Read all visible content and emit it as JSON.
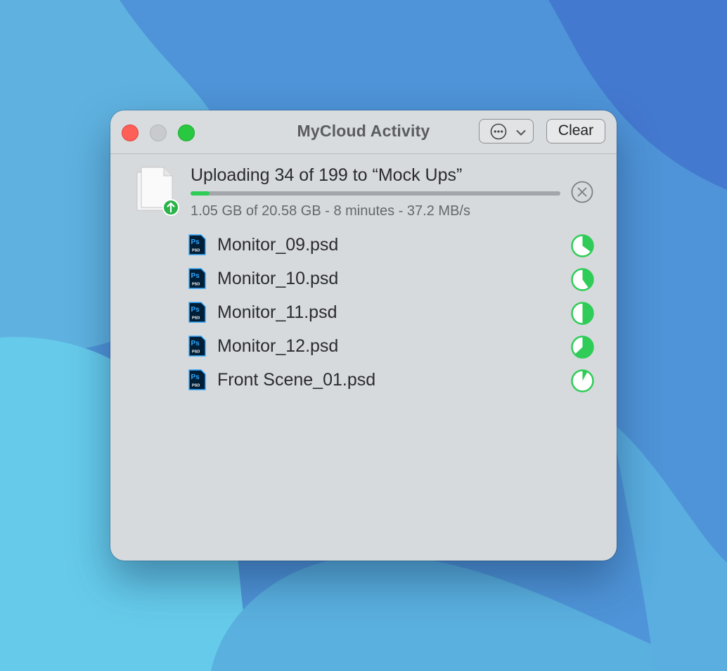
{
  "window": {
    "title": "MyCloud Activity",
    "clear_label": "Clear",
    "more_icon": "ellipsis-circle-icon",
    "dropdown_icon": "chevron-down-icon"
  },
  "upload": {
    "heading": "Uploading 34 of 199 to “Mock Ups”",
    "detail": "1.05 GB of 20.58 GB - 8 minutes - 37.2 MB/s",
    "progress": 0.051,
    "icon": "document-upload-icon",
    "cancel_icon": "cancel-x-circle-icon"
  },
  "files": [
    {
      "name": "Monitor_09.psd",
      "progress": 0.35
    },
    {
      "name": "Monitor_10.psd",
      "progress": 0.4
    },
    {
      "name": "Monitor_11.psd",
      "progress": 0.5
    },
    {
      "name": "Monitor_12.psd",
      "progress": 0.63
    },
    {
      "name": "Front Scene_01.psd",
      "progress": 0.08
    }
  ],
  "colors": {
    "accent_green": "#2fcc58",
    "close_red": "#fe5f57",
    "zoom_green": "#28c840",
    "ps_blue": "#31a8ff",
    "ps_dark": "#001e36"
  }
}
